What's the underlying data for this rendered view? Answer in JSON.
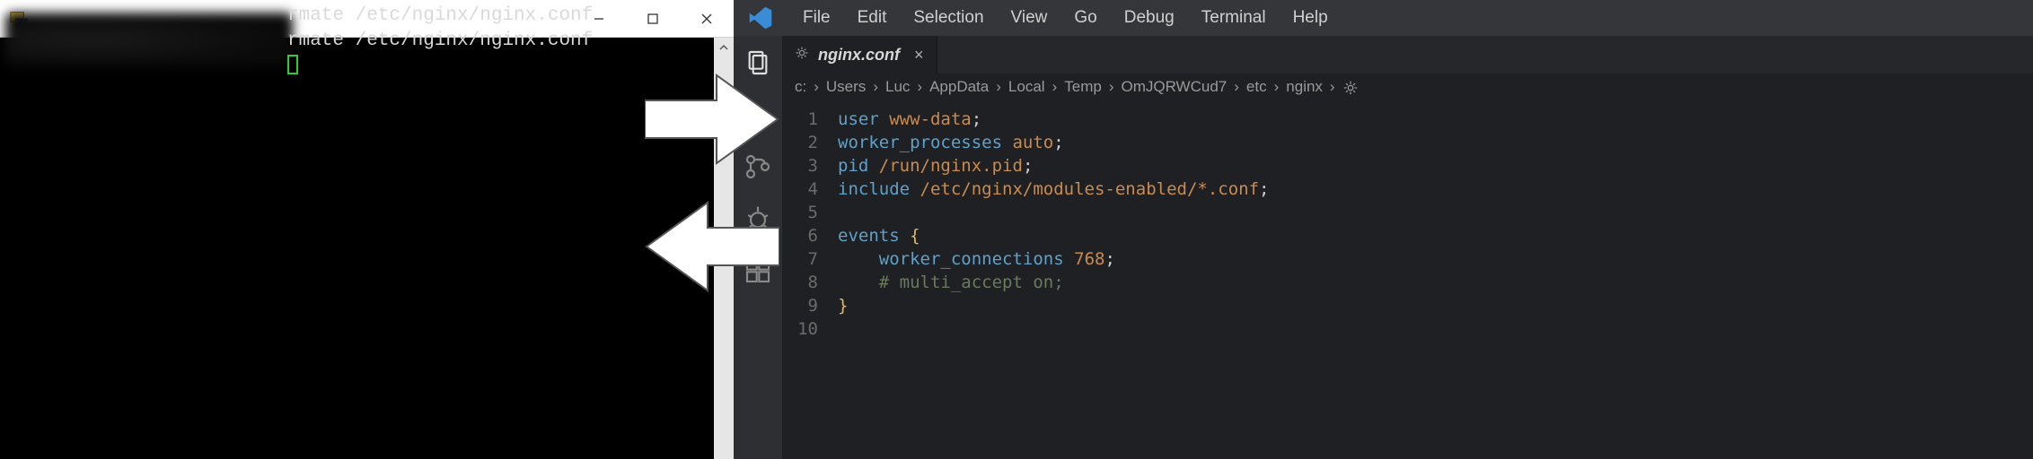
{
  "terminal": {
    "window_title": "",
    "lines": [
      "rmate /etc/nginx/nginx.conf",
      "rmate /etc/nginx/nginx.conf"
    ]
  },
  "vscode": {
    "menubar": [
      "File",
      "Edit",
      "Selection",
      "View",
      "Go",
      "Debug",
      "Terminal",
      "Help"
    ],
    "tab": {
      "filename": "nginx.conf",
      "close": "×"
    },
    "breadcrumb": [
      "c:",
      "Users",
      "Luc",
      "AppData",
      "Local",
      "Temp",
      "OmJQRWCud7",
      "etc",
      "nginx"
    ],
    "line_numbers": [
      "1",
      "2",
      "3",
      "4",
      "5",
      "6",
      "7",
      "8",
      "9",
      "10"
    ],
    "code": {
      "l1_kw": "user",
      "l1_val": "www-data",
      "l1_semi": ";",
      "l2_kw": "worker_processes",
      "l2_val": "auto",
      "l2_semi": ";",
      "l3_kw": "pid",
      "l3_val": "/run/nginx.pid",
      "l3_semi": ";",
      "l4_kw": "include",
      "l4_val": "/etc/nginx/modules-enabled/*.conf",
      "l4_semi": ";",
      "l5": "",
      "l6_kw": "events",
      "l6_brace": "{",
      "l7_kw": "worker_connections",
      "l7_val": "768",
      "l7_semi": ";",
      "l8_cmt": "# multi_accept on;",
      "l9_brace": "}",
      "l10": ""
    }
  }
}
